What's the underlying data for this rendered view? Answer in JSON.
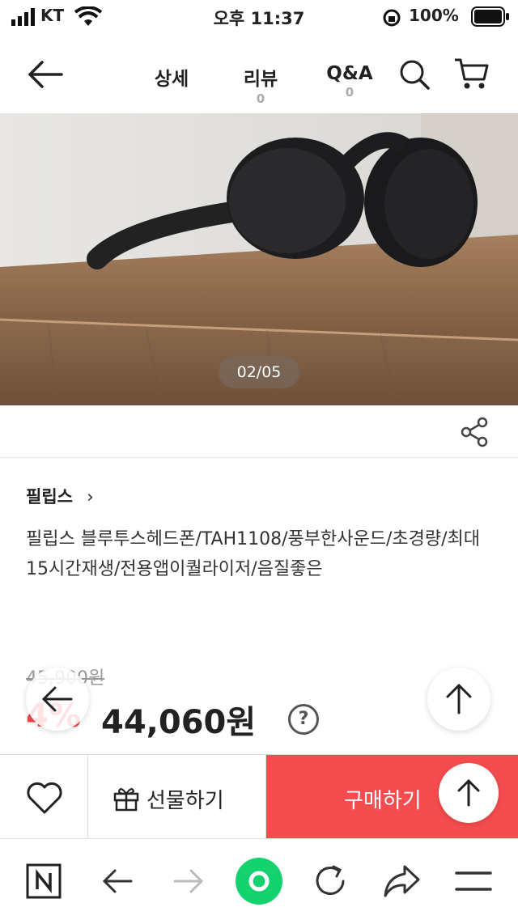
{
  "status_bar": {
    "carrier": "KT",
    "time": "오후 11:37",
    "battery": "100%"
  },
  "header": {
    "tabs": [
      {
        "label": "상세",
        "count": ""
      },
      {
        "label": "리뷰",
        "count": "0"
      },
      {
        "label": "Q&A",
        "count": "0"
      }
    ]
  },
  "gallery": {
    "pager": "02/05"
  },
  "product": {
    "brand": "필립스",
    "title": "필립스 블루투스헤드폰/TAH1108/풍부한사운드/초경량/최대15시간재생/전용앱이퀄라이저/음질좋은",
    "original_price": "45,900원",
    "discount": "4%",
    "price": "44,060원",
    "help": "?"
  },
  "buy_bar": {
    "gift_label": "선물하기",
    "buy_label": "구매하기"
  },
  "colors": {
    "accent": "#f54d4f",
    "discount": "#f04848",
    "browser_center": "#14d36f"
  },
  "icons": [
    "back-arrow-icon",
    "search-icon",
    "cart-icon",
    "share-icon",
    "heart-icon",
    "gift-icon",
    "arrow-up-icon",
    "arrow-left-icon",
    "naver-n-icon",
    "reload-icon",
    "forward-share-icon",
    "menu-icon"
  ]
}
